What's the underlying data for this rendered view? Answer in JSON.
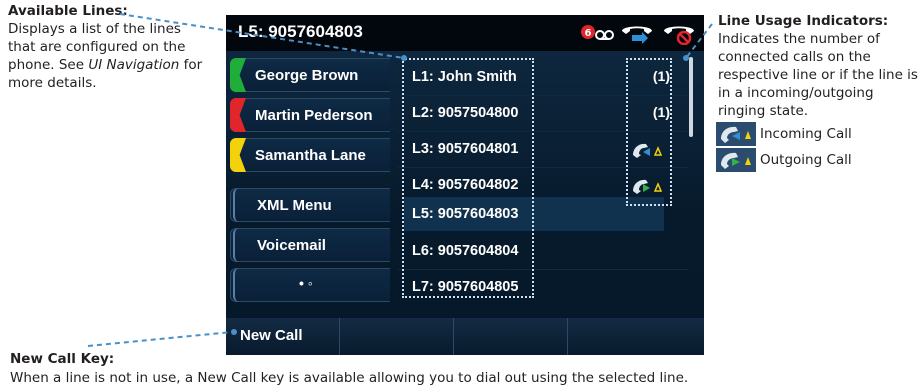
{
  "callouts": {
    "available_lines": {
      "title": "Available Lines:",
      "text_before": "Displays a list of the lines that are configured on the phone. See ",
      "link_text": "UI Navigation",
      "text_after": " for more details."
    },
    "line_usage": {
      "title": "Line Usage Indicators:",
      "text": "Indicates the number of connected calls on the respective line or if the line is in a incoming/outgoing ringing state.",
      "incoming_label": "Incoming Call",
      "outgoing_label": "Outgoing Call"
    },
    "new_call_key": {
      "title": "New Call Key:",
      "text": "When a line is not in use, a New Call key is available allowing you to dial out using the selected line."
    }
  },
  "phone": {
    "status_title": "L5: 9057604803",
    "status_badge": "6",
    "status_icons": [
      "voicemail-icon",
      "call-forward-icon",
      "do-not-disturb-icon"
    ],
    "line_keys": [
      {
        "label": "George Brown",
        "color": "#1fae3a"
      },
      {
        "label": "Martin Pederson",
        "color": "#e0262b"
      },
      {
        "label": "Samantha Lane",
        "color": "#f2d30b"
      },
      {
        "label": "XML Menu"
      },
      {
        "label": "Voicemail"
      },
      {
        "label": "• ◦"
      }
    ],
    "lines": [
      "L1: John Smith",
      "L2: 9057504800",
      "L3: 9057604801",
      "L4: 9057604802",
      "L5: 9057604803",
      "L6: 9057604804",
      "L7: 9057604805"
    ],
    "selected_line_index": 4,
    "indicators": [
      "(1)",
      "(1)",
      "incoming-call-icon",
      "outgoing-call-icon"
    ],
    "softkeys": [
      "New Call",
      "",
      "",
      ""
    ]
  },
  "colors": {
    "callout_leader": "#4a90c8",
    "screen_bg": "#071a2c",
    "incoming_arrow": "#2e8fd6",
    "outgoing_arrow": "#2fb34a",
    "ringing_bell": "#f2d30b"
  }
}
